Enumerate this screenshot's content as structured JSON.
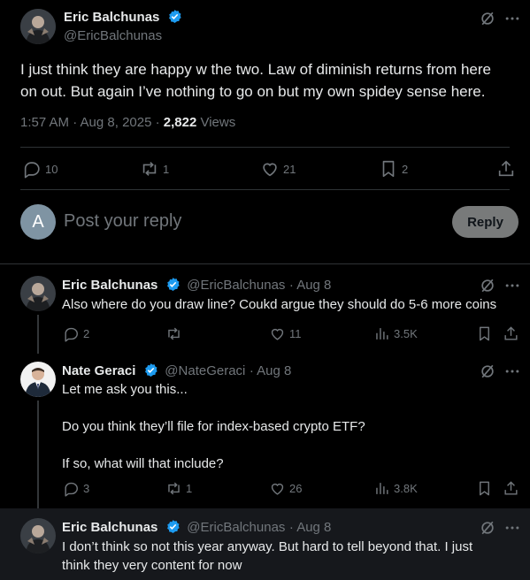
{
  "main_post": {
    "author_name": "Eric Balchunas",
    "author_handle": "@EricBalchunas",
    "text_line1": "I just think they are happy w the two. Law of diminish returns from here",
    "text_line2": "on out. But again I’ve nothing to go on but my own spidey sense here.",
    "time": "1:57 AM · Aug 8, 2025 · ",
    "views_count": "2,822",
    "views_label": " Views",
    "replies": "10",
    "reposts": "1",
    "likes": "21",
    "bookmarks": "2"
  },
  "composer": {
    "avatar_letter": "A",
    "placeholder": "Post your reply",
    "reply_label": "Reply"
  },
  "replies": [
    {
      "author_name": "Eric Balchunas",
      "author_handle": "@EricBalchunas",
      "date": "· Aug 8",
      "text": [
        "Also where do you draw line? Coukd argue they should do 5-6 more coins"
      ],
      "replies": "2",
      "reposts": "",
      "likes": "11",
      "views": "3.5K"
    },
    {
      "author_name": "Nate Geraci",
      "author_handle": "@NateGeraci",
      "date": "· Aug 8",
      "text": [
        "Let me ask you this...",
        "",
        "Do you think they’ll file for index-based crypto ETF?",
        "",
        "If so, what will that include?"
      ],
      "replies": "3",
      "reposts": "1",
      "likes": "26",
      "views": "3.8K"
    },
    {
      "author_name": "Eric Balchunas",
      "author_handle": "@EricBalchunas",
      "date": "· Aug 8",
      "text": [
        "I don’t think so not this year anyway. But hard to tell beyond that. I just",
        "think they very content for now"
      ]
    }
  ],
  "colors": {
    "background": "#000000",
    "text": "#e7e9ea",
    "muted": "#71767b",
    "verified": "#1d9bf0",
    "divider": "#2f3336",
    "highlight": "#16181c",
    "reply_button": "#787a7a"
  },
  "icons": [
    "verified-badge-icon",
    "grok-icon",
    "more-icon",
    "reply-icon",
    "repost-icon",
    "like-icon",
    "bookmark-icon",
    "share-icon",
    "views-icon"
  ]
}
